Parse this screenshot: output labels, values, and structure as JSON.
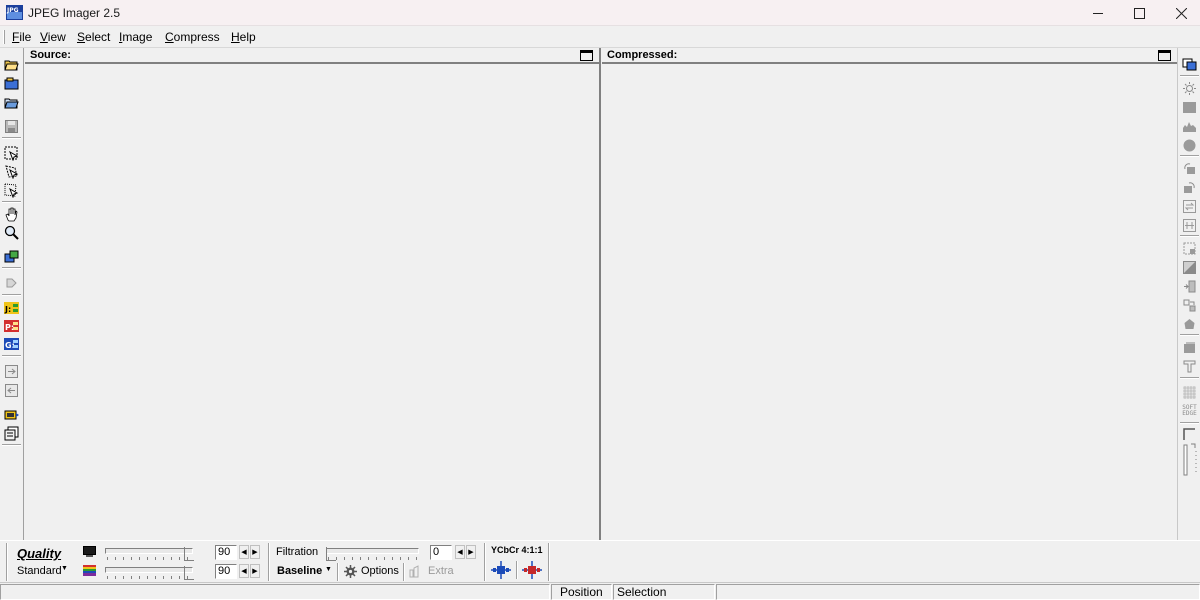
{
  "window": {
    "title": "JPEG Imager 2.5",
    "icon": "app-logo-icon",
    "controls": [
      "minimize-icon",
      "maximize-icon",
      "close-icon"
    ]
  },
  "menu": {
    "items": [
      {
        "label": "File"
      },
      {
        "label": "View"
      },
      {
        "label": "Select"
      },
      {
        "label": "Image"
      },
      {
        "label": "Compress"
      },
      {
        "label": "Help"
      }
    ]
  },
  "panes": {
    "source": {
      "title": "Source:"
    },
    "compressed": {
      "title": "Compressed:"
    }
  },
  "left_toolbar": [
    "open-icon",
    "open-multiple-icon",
    "open-folder-icon",
    "save-icon",
    "select-rect-icon",
    "select-free-icon",
    "select-auto-icon",
    "hand-icon",
    "zoom-icon",
    "transfer-icon",
    "rotate-icon",
    "jpeg-format-icon",
    "png-format-icon",
    "gif-format-icon",
    "import-icon",
    "export-icon",
    "batch-icon",
    "copy-pages-icon"
  ],
  "right_toolbar": [
    "view-both-icon",
    "brightness-icon",
    "rectangle-icon",
    "histogram-icon",
    "circle-icon",
    "rotate-left-icon",
    "rotate-right-icon",
    "flip-h-icon",
    "flip-v-icon",
    "crop-icon",
    "grayscale-icon",
    "mirror-icon",
    "transform-icon",
    "blob-icon",
    "layers-icon",
    "text-icon",
    "pattern-icon",
    "soft-edge-icon",
    "corner-icon",
    "slider-icon"
  ],
  "right_toolbar_text": {
    "soft_edge": "SOFT EDGE"
  },
  "bottom": {
    "quality": {
      "label": "Quality",
      "preset": "Standard",
      "luma_value": "90",
      "chroma_value": "90",
      "luma_level": 0.9,
      "chroma_level": 0.9
    },
    "filtration": {
      "label": "Filtration",
      "value": "0",
      "level": 0.0
    },
    "encoding": {
      "mode": "Baseline",
      "options_label": "Options",
      "extra_label": "Extra"
    },
    "subsampling": {
      "label": "YCbCr 4:1:1"
    }
  },
  "status": {
    "ratio_text": "",
    "position_label": "Position",
    "selection_label": "Selection"
  },
  "colors": {
    "title_bg": "#f7f0f2",
    "panel_bg": "#f0f0f0",
    "accent_blue": "#1c4bb8"
  }
}
